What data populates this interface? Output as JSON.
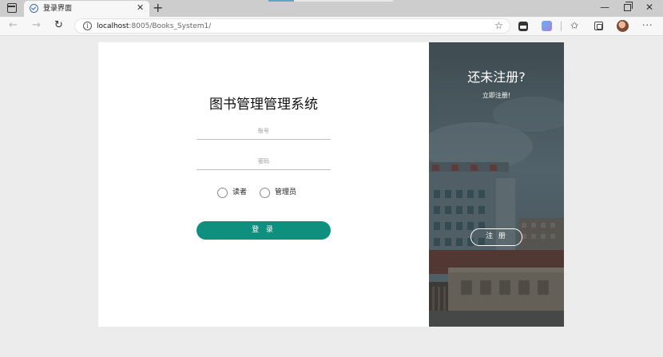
{
  "browser": {
    "tab_title": "登录界面",
    "tab_close": "✕",
    "new_tab": "+",
    "url_host": "localhost",
    "url_rest": ":8005/Books_System1/",
    "window_controls": {
      "minimize": "—",
      "close": "✕"
    },
    "nav": {
      "back": "←",
      "forward": "→",
      "reload": "↻",
      "favorites": "☆",
      "more": "···"
    },
    "icons": [
      "browser-layout-icon",
      "site-favicon-icon",
      "info-icon",
      "star-add-icon",
      "extension-icon",
      "extension-colorful-icon",
      "favorites-icon",
      "collections-icon",
      "profile-avatar",
      "more-icon"
    ]
  },
  "login": {
    "title": "图书管理管理系统",
    "username_placeholder": "账号",
    "password_placeholder": "密码",
    "roles": [
      {
        "label": "读者",
        "selected": false
      },
      {
        "label": "管理员",
        "selected": false
      }
    ],
    "submit_label": "登 录"
  },
  "side": {
    "title": "还未注册?",
    "subtitle": "立即注册!",
    "register_label": "注 册"
  },
  "colors": {
    "accent": "#0f8f7e",
    "page_background": "#ececec",
    "card_background": "#ffffff",
    "overlay": "#2c3a40"
  }
}
